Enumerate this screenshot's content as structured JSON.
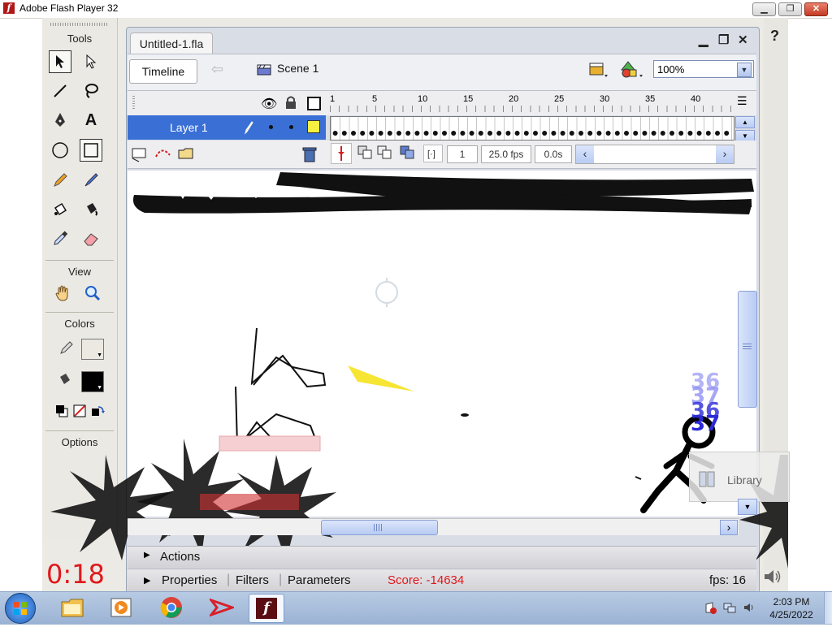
{
  "window": {
    "title": "Adobe Flash Player 32",
    "controls": {
      "minimize": "▁",
      "restore": "❐",
      "close": "✕"
    },
    "help_label": "?"
  },
  "tools_panel": {
    "title": "Tools",
    "view_label": "View",
    "colors_label": "Colors",
    "options_label": "Options"
  },
  "document": {
    "tab_label": "Untitled-1.fla",
    "timeline_button": "Timeline",
    "scene_label": "Scene 1",
    "zoom_value": "100%"
  },
  "timeline": {
    "layer_name": "Layer 1",
    "frame_ticks": [
      "1",
      "5",
      "10",
      "15",
      "20",
      "25",
      "30",
      "35",
      "40"
    ],
    "current_frame": "1",
    "frame_rate": "25.0 fps",
    "elapsed_time": "0.0s"
  },
  "panels": {
    "actions": "Actions",
    "properties": "Properties",
    "filters": "Filters",
    "parameters": "Parameters",
    "library": "Library"
  },
  "game": {
    "timer": "0:18",
    "score": "Score: -14634",
    "fps": "fps: 16",
    "damage_numbers": [
      "36",
      "37",
      "36",
      "37"
    ]
  },
  "taskbar": {
    "time": "2:03 PM",
    "date": "4/25/2022"
  },
  "colors": {
    "accent_red": "#e0181c",
    "layer_blue": "#3a6fd6",
    "damage_number_blue": "#2a2ad6"
  }
}
